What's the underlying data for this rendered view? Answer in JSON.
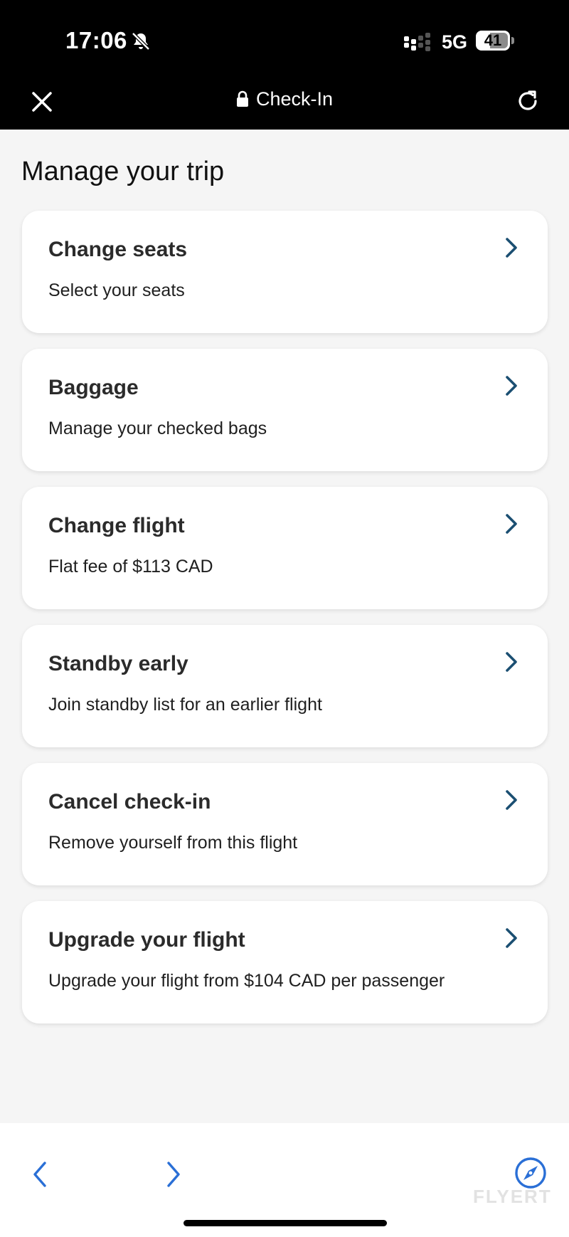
{
  "status": {
    "time": "17:06",
    "network": "5G",
    "battery": "41"
  },
  "header": {
    "title": "Check-In"
  },
  "main": {
    "title": "Manage your trip",
    "options": [
      {
        "title": "Change seats",
        "subtitle": "Select your seats"
      },
      {
        "title": "Baggage",
        "subtitle": "Manage your checked bags"
      },
      {
        "title": "Change flight",
        "subtitle": "Flat fee of $113 CAD"
      },
      {
        "title": "Standby early",
        "subtitle": "Join standby list for an earlier flight"
      },
      {
        "title": "Cancel check-in",
        "subtitle": "Remove yourself from this flight"
      },
      {
        "title": "Upgrade your flight",
        "subtitle": "Upgrade your flight from $104 CAD per passenger"
      }
    ]
  },
  "watermark": "FLYERT",
  "icons": {
    "close": "close-icon",
    "lock": "lock-icon",
    "reload": "reload-icon",
    "chevron": "chevron-right-icon",
    "back": "back-icon",
    "forward": "forward-icon",
    "compass": "compass-icon",
    "bell": "bell-slash-icon"
  },
  "colors": {
    "accent_chevron": "#1b4f72",
    "browser_blue": "#2a6fd6",
    "header_bg": "#000000",
    "page_bg": "#f5f5f5"
  }
}
